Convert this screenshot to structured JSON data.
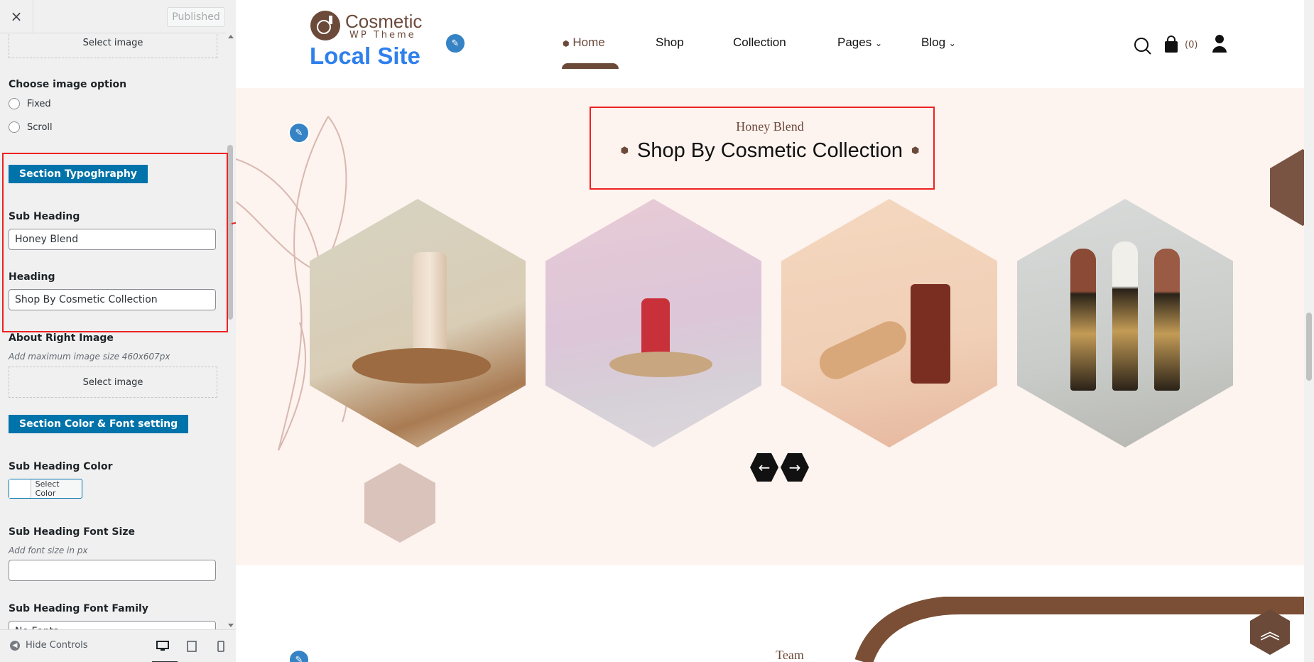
{
  "customizer": {
    "close_label": "×",
    "published_label": "Published",
    "select_image_label": "Select image",
    "image_option": {
      "label": "Choose image option",
      "options": [
        "Fixed",
        "Scroll"
      ]
    },
    "section_typography_label": "Section Typoghraphy",
    "sub_heading": {
      "label": "Sub Heading",
      "value": "Honey Blend"
    },
    "heading": {
      "label": "Heading",
      "value": "Shop By Cosmetic Collection"
    },
    "about_right_image": {
      "label": "About Right Image",
      "description": "Add maximum image size 460x607px",
      "button": "Select image"
    },
    "section_color_font_label": "Section Color & Font setting",
    "sub_heading_color": {
      "label": "Sub Heading Color",
      "button": "Select Color"
    },
    "sub_heading_font_size": {
      "label": "Sub Heading Font Size",
      "description": "Add font size in px",
      "value": ""
    },
    "sub_heading_font_family": {
      "label": "Sub Heading Font Family",
      "value": "No Fonts"
    },
    "hide_controls_label": "Hide Controls",
    "device_icons": [
      "desktop-icon",
      "tablet-icon",
      "mobile-icon"
    ]
  },
  "site": {
    "logo_name": "Cosmetic",
    "logo_tag": "WP Theme",
    "site_title": "Local Site",
    "nav": [
      "Home",
      "Shop",
      "Collection",
      "Pages",
      "Blog"
    ],
    "cart_count": "(0)",
    "section": {
      "sub_heading": "Honey Blend",
      "heading": "Shop By Cosmetic Collection"
    },
    "next_section_label": "Team"
  },
  "colors": {
    "accent": "#0073aa",
    "brand_brown": "#6b4a3a",
    "hero_bg": "#fdf3ef",
    "site_title_blue": "#2f80ed",
    "highlight_red": "#e22222"
  }
}
